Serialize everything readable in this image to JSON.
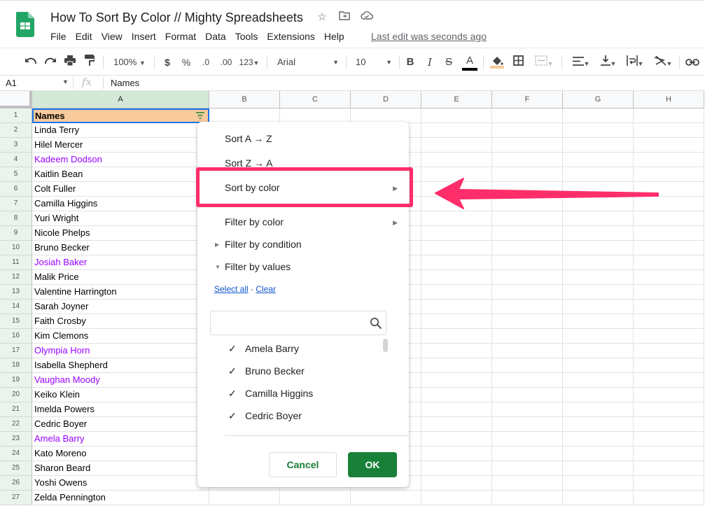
{
  "app": {
    "doc_title": "How To Sort By Color // Mighty Spreadsheets",
    "title_icons": [
      "star-icon",
      "move-to-folder-icon",
      "cloud-status-icon"
    ],
    "menu": [
      "File",
      "Edit",
      "View",
      "Insert",
      "Format",
      "Data",
      "Tools",
      "Extensions",
      "Help"
    ],
    "last_edit": "Last edit was seconds ago"
  },
  "toolbar": {
    "zoom": "100%",
    "currency": "$",
    "percent": "%",
    "decrease_decimals": ".0",
    "increase_decimals": ".00",
    "more_formats": "123",
    "font": "Arial",
    "font_size": "10",
    "bold": "B",
    "italic": "I",
    "strike": "S",
    "text_color_letter": "A",
    "text_color": "#000000",
    "fill_color": "#f9cb9c"
  },
  "formula_bar": {
    "cell_ref": "A1",
    "fx": "fx",
    "value": "Names"
  },
  "grid": {
    "columns": [
      "A",
      "B",
      "C",
      "D",
      "E",
      "F",
      "G",
      "H"
    ],
    "selected_column": "A",
    "header_fill": "#f9cb9c",
    "purple_text": "#9900ff",
    "rows": [
      {
        "n": "1",
        "value": "Names",
        "purple": false
      },
      {
        "n": "2",
        "value": "Linda Terry",
        "purple": false
      },
      {
        "n": "3",
        "value": "Hilel Mercer",
        "purple": false
      },
      {
        "n": "4",
        "value": "Kadeem Dodson",
        "purple": true
      },
      {
        "n": "5",
        "value": "Kaitlin Bean",
        "purple": false
      },
      {
        "n": "6",
        "value": "Colt Fuller",
        "purple": false
      },
      {
        "n": "7",
        "value": "Camilla Higgins",
        "purple": false
      },
      {
        "n": "8",
        "value": "Yuri Wright",
        "purple": false
      },
      {
        "n": "9",
        "value": "Nicole Phelps",
        "purple": false
      },
      {
        "n": "10",
        "value": "Bruno Becker",
        "purple": false
      },
      {
        "n": "11",
        "value": "Josiah Baker",
        "purple": true
      },
      {
        "n": "12",
        "value": "Malik Price",
        "purple": false
      },
      {
        "n": "13",
        "value": "Valentine Harrington",
        "purple": false
      },
      {
        "n": "14",
        "value": "Sarah Joyner",
        "purple": false
      },
      {
        "n": "15",
        "value": "Faith Crosby",
        "purple": false
      },
      {
        "n": "16",
        "value": "Kim Clemons",
        "purple": false
      },
      {
        "n": "17",
        "value": "Olympia Horn",
        "purple": true
      },
      {
        "n": "18",
        "value": "Isabella Shepherd",
        "purple": false
      },
      {
        "n": "19",
        "value": "Vaughan Moody",
        "purple": true
      },
      {
        "n": "20",
        "value": "Keiko Klein",
        "purple": false
      },
      {
        "n": "21",
        "value": "Imelda Powers",
        "purple": false
      },
      {
        "n": "22",
        "value": "Cedric Boyer",
        "purple": false
      },
      {
        "n": "23",
        "value": "Amela Barry",
        "purple": true
      },
      {
        "n": "24",
        "value": "Kato Moreno",
        "purple": false
      },
      {
        "n": "25",
        "value": "Sharon Beard",
        "purple": false
      },
      {
        "n": "26",
        "value": "Yoshi Owens",
        "purple": false
      },
      {
        "n": "27",
        "value": "Zelda Pennington",
        "purple": false
      }
    ]
  },
  "filter_menu": {
    "sort_az": "Sort A → Z",
    "sort_za": "Sort Z → A",
    "sort_by_color": "Sort by color",
    "filter_by_color": "Filter by color",
    "filter_by_condition": "Filter by condition",
    "filter_by_values": "Filter by values",
    "select_all": "Select all",
    "separator": " - ",
    "clear": "Clear",
    "search_placeholder": "",
    "values": [
      {
        "label": "Amela Barry",
        "checked": true
      },
      {
        "label": "Bruno Becker",
        "checked": true
      },
      {
        "label": "Camilla Higgins",
        "checked": true
      },
      {
        "label": "Cedric Boyer",
        "checked": true
      }
    ],
    "cancel": "Cancel",
    "ok": "OK"
  },
  "annotation": {
    "highlight_color": "#ff2e6b",
    "target": "Sort by color"
  }
}
